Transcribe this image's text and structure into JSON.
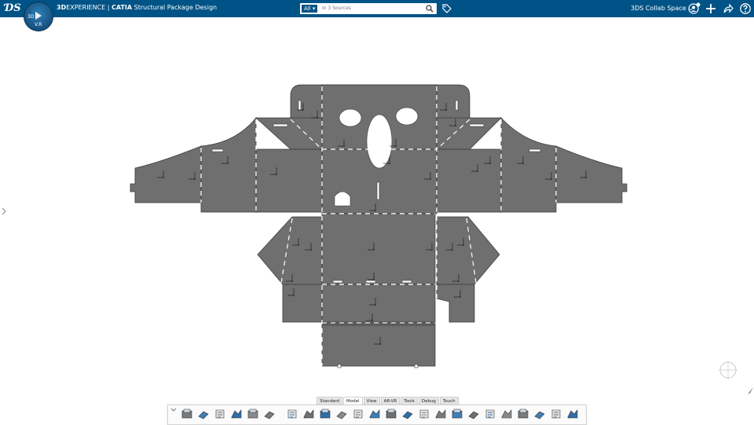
{
  "header": {
    "brand_bold": "3D",
    "brand_rest": "EXPERIENCE",
    "separator": " | ",
    "product": "CATIA",
    "app_name": " Structural Package Design",
    "compass_version": "V.R",
    "compass_3d": "3D",
    "search_filter": "All",
    "search_placeholder": "In 3 Sources",
    "collab_space": "3DS Collab Space",
    "icons": [
      "search-icon",
      "tag-icon",
      "user-icon",
      "plus-icon",
      "share-icon",
      "help-icon"
    ]
  },
  "tabs": [
    "Standard",
    "Model",
    "View",
    "AR-VR",
    "Tools",
    "Debug",
    "Touch"
  ],
  "active_tab": "Model",
  "actionbar_icons": [
    "cut-icon",
    "copy-icon",
    "paste-icon",
    "undo-icon",
    "update-icon",
    "fly-icon",
    "tree-icon",
    "sketch-icon",
    "point-icon",
    "wall-icon",
    "flange-icon",
    "flap-icon",
    "fold-icon",
    "lid-icon",
    "panel-icon",
    "tab-icon",
    "unfold-icon",
    "fold-view-icon",
    "cutout-icon",
    "bend-icon",
    "hole-icon",
    "stamp-icon",
    "layout-icon",
    "analysis-icon"
  ],
  "colors": {
    "header_bg": "#005386",
    "part_fill": "#6f6f6f",
    "part_stroke": "#3c3c3c"
  }
}
